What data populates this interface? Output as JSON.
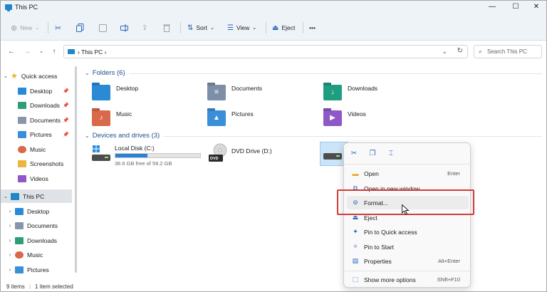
{
  "window": {
    "title": "This PC",
    "minimize": "—",
    "maximize": "☐",
    "close": "✕"
  },
  "toolbar": {
    "new_label": "New",
    "sort_label": "Sort",
    "view_label": "View",
    "eject_label": "Eject",
    "more_label": "•••"
  },
  "address": {
    "path": "This PC",
    "separator": "›",
    "search_placeholder": "Search This PC"
  },
  "sidebar": {
    "quick_access": "Quick access",
    "quick_items": [
      {
        "label": "Desktop",
        "color": "#2a8ad6"
      },
      {
        "label": "Downloads",
        "color": "#2f9e77"
      },
      {
        "label": "Documents",
        "color": "#8796a8"
      },
      {
        "label": "Pictures",
        "color": "#3a8fd8"
      },
      {
        "label": "Music",
        "color": "#d9694b"
      },
      {
        "label": "Screenshots",
        "color": "#e9b640"
      },
      {
        "label": "Videos",
        "color": "#8e58c6"
      }
    ],
    "this_pc": "This PC",
    "pc_items": [
      {
        "label": "Desktop",
        "color": "#2a8ad6"
      },
      {
        "label": "Documents",
        "color": "#8796a8"
      },
      {
        "label": "Downloads",
        "color": "#2f9e77"
      },
      {
        "label": "Music",
        "color": "#d9694b"
      },
      {
        "label": "Pictures",
        "color": "#3a8fd8"
      }
    ]
  },
  "folders": {
    "header": "Folders (6)",
    "items": [
      {
        "name": "Desktop",
        "color": "#2a8ad6"
      },
      {
        "name": "Documents",
        "color": "#7d8fa6"
      },
      {
        "name": "Downloads",
        "color": "#1f9e7f"
      },
      {
        "name": "Music",
        "color": "#d9694b"
      },
      {
        "name": "Pictures",
        "color": "#3a8fd8"
      },
      {
        "name": "Videos",
        "color": "#8e58c6"
      }
    ]
  },
  "drives": {
    "header": "Devices and drives (3)",
    "local": {
      "name": "Local Disk (C:)",
      "free_text": "36.6 GB free of 59.2 GB",
      "used_fraction": 0.38
    },
    "dvd": {
      "name": "DVD Drive (D:)",
      "badge": "DVD"
    }
  },
  "context_menu": {
    "items": [
      {
        "label": "Open",
        "shortcut": "Enter"
      },
      {
        "label": "Open in new window",
        "shortcut": ""
      },
      {
        "label": "Format...",
        "shortcut": ""
      },
      {
        "label": "Eject",
        "shortcut": ""
      },
      {
        "label": "Pin to Quick access",
        "shortcut": ""
      },
      {
        "label": "Pin to Start",
        "shortcut": ""
      },
      {
        "label": "Properties",
        "shortcut": "Alt+Enter"
      },
      {
        "label": "Show more options",
        "shortcut": "Shift+F10"
      }
    ]
  },
  "status": {
    "items_count": "9 items",
    "selected": "1 item selected"
  }
}
